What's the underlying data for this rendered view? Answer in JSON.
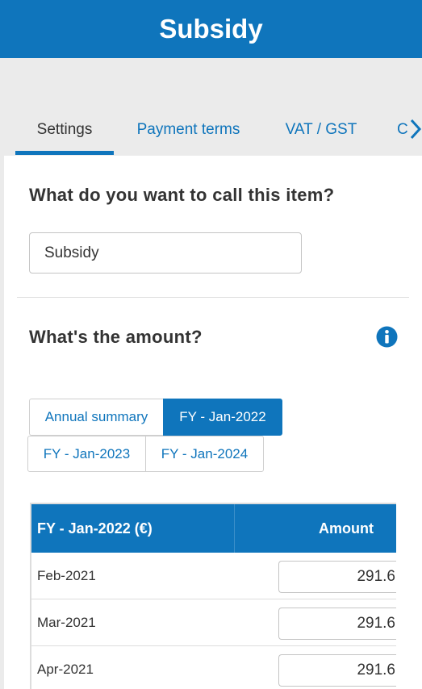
{
  "header": {
    "title": "Subsidy"
  },
  "tabs": [
    {
      "label": "Settings",
      "active": true
    },
    {
      "label": "Payment terms",
      "active": false
    },
    {
      "label": "VAT / GST",
      "active": false
    },
    {
      "label": "C",
      "active": false
    }
  ],
  "name_section": {
    "question": "What do you want to call this item?",
    "value": "Subsidy"
  },
  "amount_section": {
    "question": "What's the amount?",
    "periods": [
      {
        "label": "Annual summary",
        "active": false
      },
      {
        "label": "FY - Jan-2022",
        "active": true
      },
      {
        "label": "FY - Jan-2023",
        "active": false
      },
      {
        "label": "FY - Jan-2024",
        "active": false
      }
    ],
    "table": {
      "col_month": "FY - Jan-2022 (€)",
      "col_amount": "Amount",
      "rows": [
        {
          "month": "Feb-2021",
          "amount": "291.6"
        },
        {
          "month": "Mar-2021",
          "amount": "291.6"
        },
        {
          "month": "Apr-2021",
          "amount": "291.6"
        }
      ]
    }
  },
  "colors": {
    "brand": "#0f75bc",
    "background": "#ebebeb",
    "card": "#ffffff"
  },
  "icons": {
    "tabs_scroll": "chevron-right-icon",
    "info": "info-circle-icon"
  }
}
